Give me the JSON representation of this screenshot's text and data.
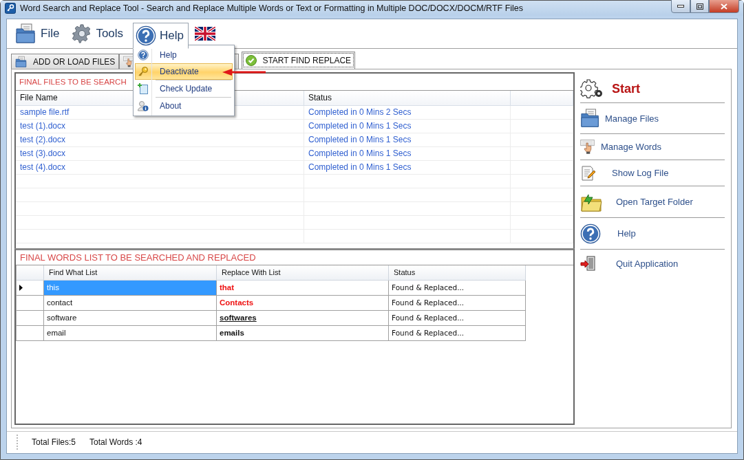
{
  "window": {
    "title": "Word Search and Replace Tool - Search and Replace Multiple Words or Text  or Formatting in Multiple DOC/DOCX/DOCM/RTF Files"
  },
  "menus": [
    {
      "label": "File",
      "open": false
    },
    {
      "label": "Tools",
      "open": false
    },
    {
      "label": "Help",
      "open": true,
      "items": [
        {
          "label": "Help",
          "selected": false
        },
        {
          "label": "Deactivate",
          "selected": true
        },
        {
          "label": "Check Update",
          "selected": false
        },
        {
          "label": "About",
          "selected": false
        }
      ]
    }
  ],
  "tabs": [
    {
      "label": "ADD OR LOAD FILES",
      "selected": false
    },
    {
      "selected": false
    },
    {
      "label": "START FIND REPLACE",
      "selected": true
    }
  ],
  "files_panel": {
    "title": "FINAL FILES TO BE SEARCH",
    "columns": [
      "File Name",
      "Status"
    ],
    "rows": [
      {
        "name": "sample file.rtf",
        "status": "Completed in 0 Mins 2 Secs"
      },
      {
        "name": "test (1).docx",
        "status": "Completed in 0 Mins 1 Secs"
      },
      {
        "name": "test (2).docx",
        "status": "Completed in 0 Mins 1 Secs"
      },
      {
        "name": "test (3).docx",
        "status": "Completed in 0 Mins 1 Secs"
      },
      {
        "name": "test (4).docx",
        "status": "Completed in 0 Mins 1 Secs"
      }
    ]
  },
  "words_panel": {
    "title": "FINAL WORDS LIST TO BE SEARCHED AND REPLACED",
    "columns": [
      "Find What List",
      "Replace With List",
      "Status"
    ],
    "rows": [
      {
        "find": "this",
        "replace": "that",
        "kind": "red",
        "status": "Found & Replaced...",
        "selected": true
      },
      {
        "find": "contact",
        "replace": "Contacts",
        "kind": "red",
        "status": "Found & Replaced...",
        "selected": false
      },
      {
        "find": "software",
        "replace": "softwares",
        "kind": "underline",
        "status": "Found & Replaced...",
        "selected": false
      },
      {
        "find": "email",
        "replace": "emails",
        "kind": "bold",
        "status": "Found & Replaced...",
        "selected": false
      }
    ]
  },
  "sidebar": {
    "items": [
      {
        "label": "Start",
        "kind": "primary"
      },
      {
        "label": "Manage Files",
        "kind": "normal"
      },
      {
        "label": "Manage Words",
        "kind": "normal"
      },
      {
        "label": "Show Log File",
        "kind": "normal"
      },
      {
        "label": "Open Target Folder",
        "kind": "normal"
      },
      {
        "label": "Help",
        "kind": "normal"
      },
      {
        "label": "Quit Application",
        "kind": "normal"
      }
    ]
  },
  "status_bar": {
    "total_files": "Total Files:5",
    "total_words": "Total Words :4"
  }
}
